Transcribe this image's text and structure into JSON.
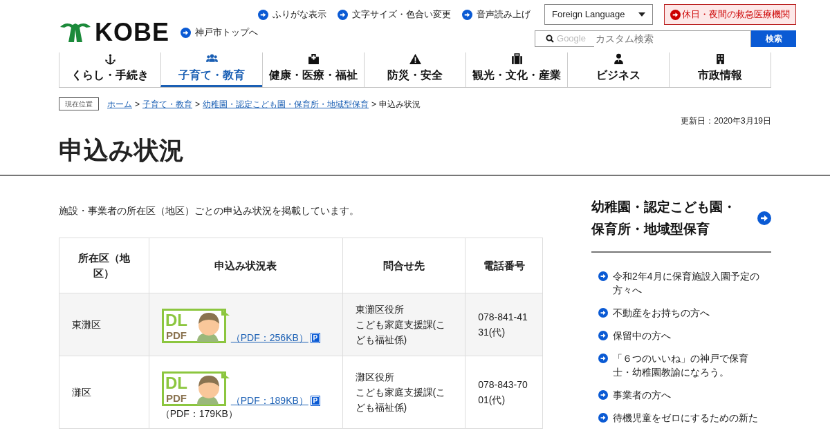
{
  "header": {
    "logo": "KOBE",
    "top_link": "神戸市トップへ",
    "utility_links": [
      "ふりがな表示",
      "文字サイズ・色合い変更",
      "音声読み上げ"
    ],
    "language_select": "Foreign Language",
    "emergency_button": "休日・夜間の救急医療機関",
    "search": {
      "brand": "Google",
      "placeholder": "カスタム検索",
      "button": "検索"
    }
  },
  "nav": [
    {
      "label": "くらし・手続き",
      "selected": false
    },
    {
      "label": "子育て・教育",
      "selected": true
    },
    {
      "label": "健康・医療・福祉",
      "selected": false
    },
    {
      "label": "防災・安全",
      "selected": false
    },
    {
      "label": "観光・文化・産業",
      "selected": false
    },
    {
      "label": "ビジネス",
      "selected": false
    },
    {
      "label": "市政情報",
      "selected": false
    }
  ],
  "breadcrumb": {
    "tag": "現在位置",
    "links": [
      "ホーム",
      "子育て・教育",
      "幼稚園・認定こども園・保育所・地域型保育"
    ],
    "current": "申込み状況",
    "separator": ">"
  },
  "updated": "更新日：2020年3月19日",
  "title": "申込み状況",
  "intro": "施設・事業者の所在区（地区）ごとの申込み状況を掲載しています。",
  "table": {
    "columns": [
      "所在区（地区）",
      "申込み状況表",
      "問合せ先",
      "電話番号"
    ],
    "rows": [
      {
        "district": "東灘区",
        "badge": [
          "DL",
          "PDF"
        ],
        "link": "（PDF：256KB）",
        "pdf_mark": "P",
        "note": "",
        "contact": [
          "東灘区役所",
          "こども家庭支援課(こども福祉係)"
        ],
        "phone": "078-841-4131(代)"
      },
      {
        "district": "灘区",
        "badge": [
          "DL",
          "PDF"
        ],
        "link": "（PDF：189KB）",
        "pdf_mark": "P",
        "note": "（PDF：179KB）",
        "contact": [
          "灘区役所",
          "こども家庭支援課(こども福祉係)"
        ],
        "phone": "078-843-7001(代)"
      }
    ]
  },
  "sidebar": {
    "heading": "幼稚園・認定こども園・保育所・地域型保育",
    "items": [
      "令和2年4月に保育施設入園予定の方々へ",
      "不動産をお持ちの方へ",
      "保留中の方へ",
      "「６つのいいね」の神戸で保育士・幼稚園教諭になろう。",
      "事業者の方へ",
      "待機児童をゼロにするための新た"
    ]
  }
}
